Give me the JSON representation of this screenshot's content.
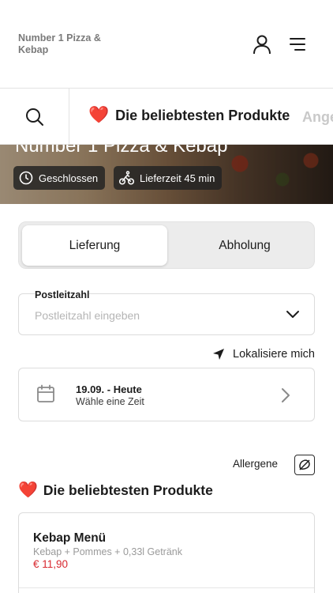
{
  "header": {
    "brand": "Number 1 Pizza & Kebap",
    "icons": {
      "account": "user-icon",
      "menu": "hamburger-menu-icon"
    }
  },
  "category_bar": {
    "search_icon": "search-icon",
    "active_category": {
      "emoji": "❤️",
      "label": "Die beliebtesten Produkte"
    },
    "next_category_partial": "Ange"
  },
  "hero": {
    "title": "Number 1 Pizza & Kebap",
    "status": {
      "icon": "clock-icon",
      "label": "Geschlossen"
    },
    "delivery": {
      "icon": "bicycle-icon",
      "label": "Lieferzeit 45 min"
    }
  },
  "order_mode": {
    "options": [
      "Lieferung",
      "Abholung"
    ],
    "selected": "Lieferung"
  },
  "postal": {
    "label": "Postleitzahl",
    "placeholder": "Postleitzahl eingeben",
    "value": ""
  },
  "locate": {
    "icon": "location-arrow-icon",
    "label": "Lokalisiere mich"
  },
  "schedule": {
    "icon": "calendar-icon",
    "date": "19.09. - Heute",
    "prompt": "Wähle eine Zeit"
  },
  "allergens": {
    "label": "Allergene",
    "icon": "allergen-icon"
  },
  "popular_section": {
    "emoji": "❤️",
    "title": "Die beliebtesten Produkte",
    "products": [
      {
        "name": "Kebap Menü",
        "description": "Kebap + Pommes + 0,33l Getränk",
        "price": "€ 11,90"
      }
    ]
  },
  "colors": {
    "accent_red": "#d8282f",
    "heart": "#e02424",
    "text": "#1c1c1c",
    "muted": "#9a9a9a"
  }
}
